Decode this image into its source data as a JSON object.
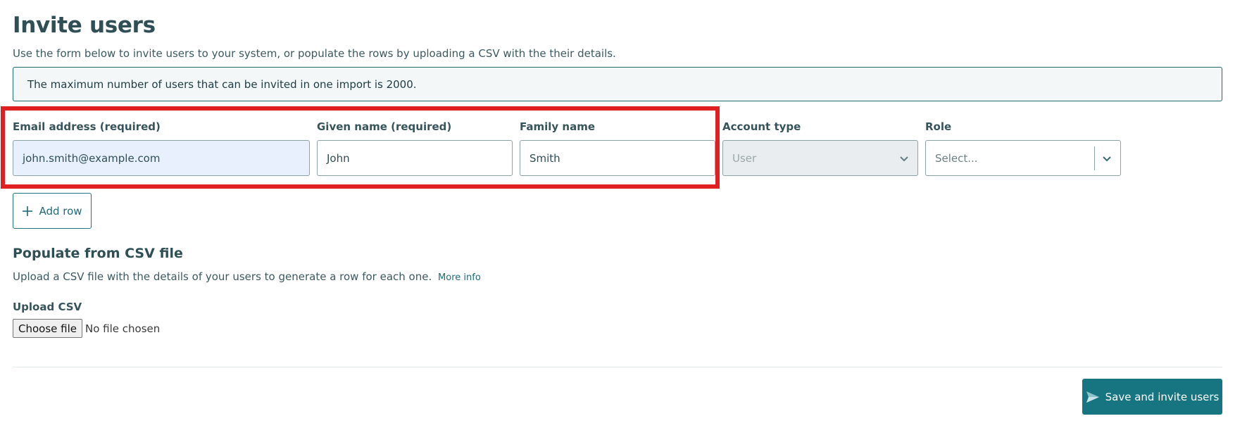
{
  "page": {
    "title": "Invite users",
    "intro": "Use the form below to invite users to your system, or populate the rows by uploading a CSV with the their details.",
    "notice": "The maximum number of users that can be invited in one import is 2000."
  },
  "form": {
    "email": {
      "label": "Email address (required)",
      "value": "john.smith@example.com"
    },
    "given_name": {
      "label": "Given name (required)",
      "value": "John"
    },
    "family_name": {
      "label": "Family name",
      "value": "Smith"
    },
    "account_type": {
      "label": "Account type",
      "value": "User",
      "disabled": true
    },
    "role": {
      "label": "Role",
      "placeholder": "Select..."
    },
    "add_row_label": "Add row"
  },
  "csv": {
    "heading": "Populate from CSV file",
    "description": "Upload a CSV file with the details of your users to generate a row for each one.",
    "more_info": "More info",
    "upload_label": "Upload CSV",
    "choose_file": "Choose file",
    "no_file": "No file chosen"
  },
  "actions": {
    "save_label": "Save and invite users"
  },
  "colors": {
    "primary": "#177582",
    "heading": "#2f4f55",
    "highlight": "#e02020",
    "autofill": "#e8f0fe"
  },
  "icons": {
    "add_row": "plus-icon",
    "select": "chevron-down-icon",
    "save": "send-icon"
  }
}
